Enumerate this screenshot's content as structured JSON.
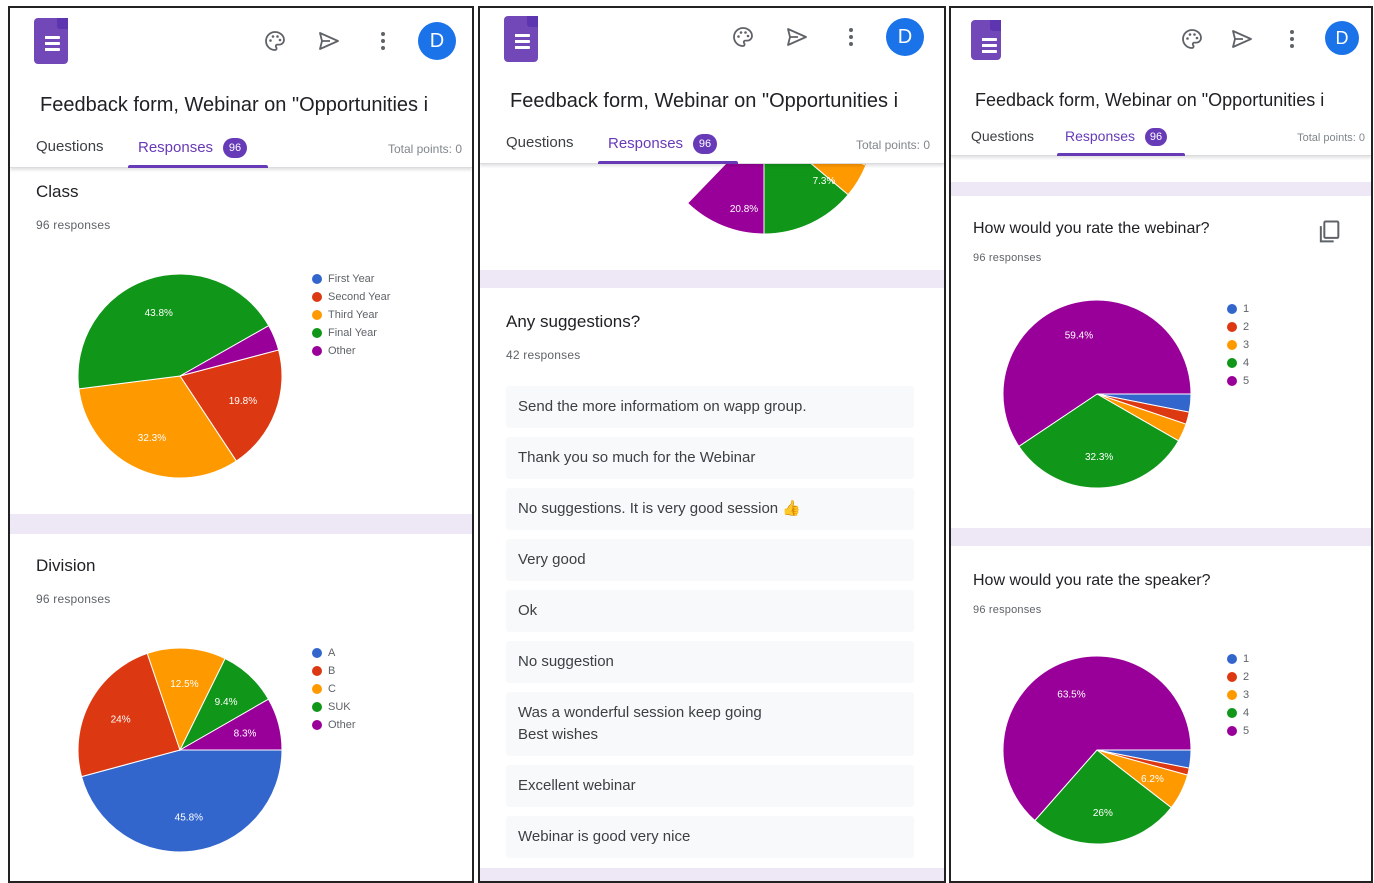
{
  "form": {
    "title": "Feedback form, Webinar on \"Opportunities i",
    "avatar_initial": "D",
    "tabs": {
      "questions": "Questions",
      "responses": "Responses",
      "responses_count": "96"
    },
    "total_points": "Total points: 0"
  },
  "icons": [
    "forms-logo-icon",
    "palette-icon",
    "send-icon",
    "more-vert-icon",
    "copy-icon"
  ],
  "colors": {
    "accent": "#673ab7",
    "blue": "#3366cc",
    "red": "#dc3912",
    "orange": "#ff9900",
    "green": "#109618",
    "purple": "#990099"
  },
  "panel1": {
    "class_q": {
      "title": "Class",
      "count": "96 responses",
      "legend": [
        "First Year",
        "Second Year",
        "Third Year",
        "Final Year",
        "Other"
      ],
      "labels": [
        "43.8%",
        "32.3%",
        "19.8%"
      ]
    },
    "division_q": {
      "title": "Division",
      "count": "96 responses",
      "legend": [
        "A",
        "B",
        "C",
        "SUK",
        "Other"
      ],
      "labels": [
        "45.8%",
        "24%",
        "12.5%",
        "9.4%",
        "8.3%"
      ]
    }
  },
  "panel2": {
    "partial_labels": [
      "20.8%",
      "7.3%"
    ],
    "suggestions": {
      "title": "Any suggestions?",
      "count": "42 responses",
      "responses": [
        "Send the more informatiom on wapp group.",
        "Thank you so much for the Webinar",
        "No suggestions. It is very good session 👍",
        "Very good",
        "Ok",
        "No suggestion",
        "Was a wonderful session keep going\nBest wishes",
        "Excellent webinar",
        "Webinar is good very nice"
      ]
    }
  },
  "panel3": {
    "webinar_q": {
      "title": "How would you rate the webinar?",
      "count": "96 responses",
      "legend": [
        "1",
        "2",
        "3",
        "4",
        "5"
      ],
      "labels": [
        "59.4%",
        "32.3%"
      ]
    },
    "speaker_q": {
      "title": "How would you rate the speaker?",
      "count": "96 responses",
      "legend": [
        "1",
        "2",
        "3",
        "4",
        "5"
      ],
      "labels": [
        "63.5%",
        "26%",
        "6.2%"
      ]
    }
  },
  "chart_data": [
    {
      "type": "pie",
      "title": "Class",
      "categories": [
        "First Year",
        "Second Year",
        "Third Year",
        "Final Year",
        "Other"
      ],
      "values": [
        0,
        19.8,
        32.3,
        43.8,
        4.1
      ],
      "legend_position": "right"
    },
    {
      "type": "pie",
      "title": "Division",
      "categories": [
        "A",
        "B",
        "C",
        "SUK",
        "Other"
      ],
      "values": [
        45.8,
        24,
        12.5,
        9.4,
        8.3
      ],
      "legend_position": "right"
    },
    {
      "type": "pie",
      "title": "How would you rate the webinar?",
      "categories": [
        "1",
        "2",
        "3",
        "4",
        "5"
      ],
      "values": [
        3.1,
        2.1,
        3.1,
        32.3,
        59.4
      ],
      "legend_position": "right"
    },
    {
      "type": "pie",
      "title": "How would you rate the speaker?",
      "categories": [
        "1",
        "2",
        "3",
        "4",
        "5"
      ],
      "values": [
        3.1,
        1.2,
        6.2,
        26,
        63.5
      ],
      "legend_position": "right"
    }
  ]
}
